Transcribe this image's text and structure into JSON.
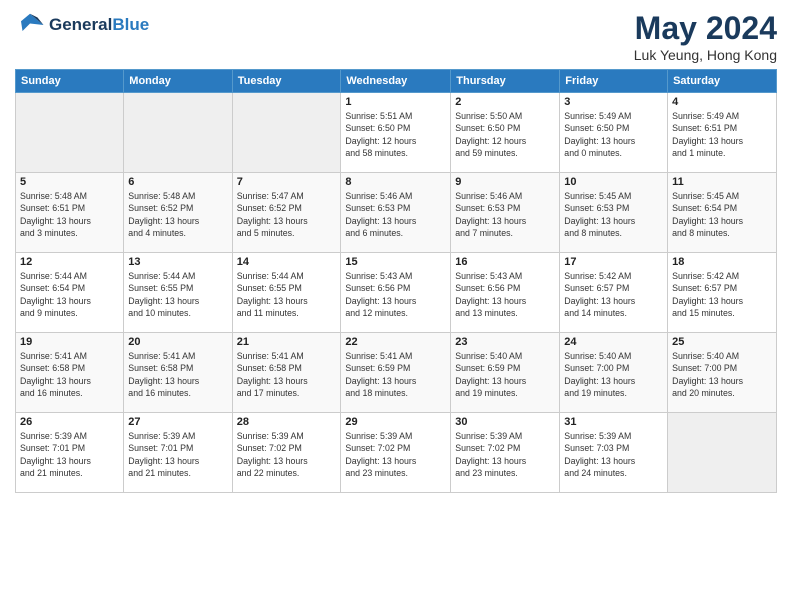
{
  "header": {
    "logo_line1": "General",
    "logo_line2": "Blue",
    "month_year": "May 2024",
    "location": "Luk Yeung, Hong Kong"
  },
  "weekdays": [
    "Sunday",
    "Monday",
    "Tuesday",
    "Wednesday",
    "Thursday",
    "Friday",
    "Saturday"
  ],
  "weeks": [
    [
      {
        "day": "",
        "info": ""
      },
      {
        "day": "",
        "info": ""
      },
      {
        "day": "",
        "info": ""
      },
      {
        "day": "1",
        "info": "Sunrise: 5:51 AM\nSunset: 6:50 PM\nDaylight: 12 hours\nand 58 minutes."
      },
      {
        "day": "2",
        "info": "Sunrise: 5:50 AM\nSunset: 6:50 PM\nDaylight: 12 hours\nand 59 minutes."
      },
      {
        "day": "3",
        "info": "Sunrise: 5:49 AM\nSunset: 6:50 PM\nDaylight: 13 hours\nand 0 minutes."
      },
      {
        "day": "4",
        "info": "Sunrise: 5:49 AM\nSunset: 6:51 PM\nDaylight: 13 hours\nand 1 minute."
      }
    ],
    [
      {
        "day": "5",
        "info": "Sunrise: 5:48 AM\nSunset: 6:51 PM\nDaylight: 13 hours\nand 3 minutes."
      },
      {
        "day": "6",
        "info": "Sunrise: 5:48 AM\nSunset: 6:52 PM\nDaylight: 13 hours\nand 4 minutes."
      },
      {
        "day": "7",
        "info": "Sunrise: 5:47 AM\nSunset: 6:52 PM\nDaylight: 13 hours\nand 5 minutes."
      },
      {
        "day": "8",
        "info": "Sunrise: 5:46 AM\nSunset: 6:53 PM\nDaylight: 13 hours\nand 6 minutes."
      },
      {
        "day": "9",
        "info": "Sunrise: 5:46 AM\nSunset: 6:53 PM\nDaylight: 13 hours\nand 7 minutes."
      },
      {
        "day": "10",
        "info": "Sunrise: 5:45 AM\nSunset: 6:53 PM\nDaylight: 13 hours\nand 8 minutes."
      },
      {
        "day": "11",
        "info": "Sunrise: 5:45 AM\nSunset: 6:54 PM\nDaylight: 13 hours\nand 8 minutes."
      }
    ],
    [
      {
        "day": "12",
        "info": "Sunrise: 5:44 AM\nSunset: 6:54 PM\nDaylight: 13 hours\nand 9 minutes."
      },
      {
        "day": "13",
        "info": "Sunrise: 5:44 AM\nSunset: 6:55 PM\nDaylight: 13 hours\nand 10 minutes."
      },
      {
        "day": "14",
        "info": "Sunrise: 5:44 AM\nSunset: 6:55 PM\nDaylight: 13 hours\nand 11 minutes."
      },
      {
        "day": "15",
        "info": "Sunrise: 5:43 AM\nSunset: 6:56 PM\nDaylight: 13 hours\nand 12 minutes."
      },
      {
        "day": "16",
        "info": "Sunrise: 5:43 AM\nSunset: 6:56 PM\nDaylight: 13 hours\nand 13 minutes."
      },
      {
        "day": "17",
        "info": "Sunrise: 5:42 AM\nSunset: 6:57 PM\nDaylight: 13 hours\nand 14 minutes."
      },
      {
        "day": "18",
        "info": "Sunrise: 5:42 AM\nSunset: 6:57 PM\nDaylight: 13 hours\nand 15 minutes."
      }
    ],
    [
      {
        "day": "19",
        "info": "Sunrise: 5:41 AM\nSunset: 6:58 PM\nDaylight: 13 hours\nand 16 minutes."
      },
      {
        "day": "20",
        "info": "Sunrise: 5:41 AM\nSunset: 6:58 PM\nDaylight: 13 hours\nand 16 minutes."
      },
      {
        "day": "21",
        "info": "Sunrise: 5:41 AM\nSunset: 6:58 PM\nDaylight: 13 hours\nand 17 minutes."
      },
      {
        "day": "22",
        "info": "Sunrise: 5:41 AM\nSunset: 6:59 PM\nDaylight: 13 hours\nand 18 minutes."
      },
      {
        "day": "23",
        "info": "Sunrise: 5:40 AM\nSunset: 6:59 PM\nDaylight: 13 hours\nand 19 minutes."
      },
      {
        "day": "24",
        "info": "Sunrise: 5:40 AM\nSunset: 7:00 PM\nDaylight: 13 hours\nand 19 minutes."
      },
      {
        "day": "25",
        "info": "Sunrise: 5:40 AM\nSunset: 7:00 PM\nDaylight: 13 hours\nand 20 minutes."
      }
    ],
    [
      {
        "day": "26",
        "info": "Sunrise: 5:39 AM\nSunset: 7:01 PM\nDaylight: 13 hours\nand 21 minutes."
      },
      {
        "day": "27",
        "info": "Sunrise: 5:39 AM\nSunset: 7:01 PM\nDaylight: 13 hours\nand 21 minutes."
      },
      {
        "day": "28",
        "info": "Sunrise: 5:39 AM\nSunset: 7:02 PM\nDaylight: 13 hours\nand 22 minutes."
      },
      {
        "day": "29",
        "info": "Sunrise: 5:39 AM\nSunset: 7:02 PM\nDaylight: 13 hours\nand 23 minutes."
      },
      {
        "day": "30",
        "info": "Sunrise: 5:39 AM\nSunset: 7:02 PM\nDaylight: 13 hours\nand 23 minutes."
      },
      {
        "day": "31",
        "info": "Sunrise: 5:39 AM\nSunset: 7:03 PM\nDaylight: 13 hours\nand 24 minutes."
      },
      {
        "day": "",
        "info": ""
      }
    ]
  ]
}
